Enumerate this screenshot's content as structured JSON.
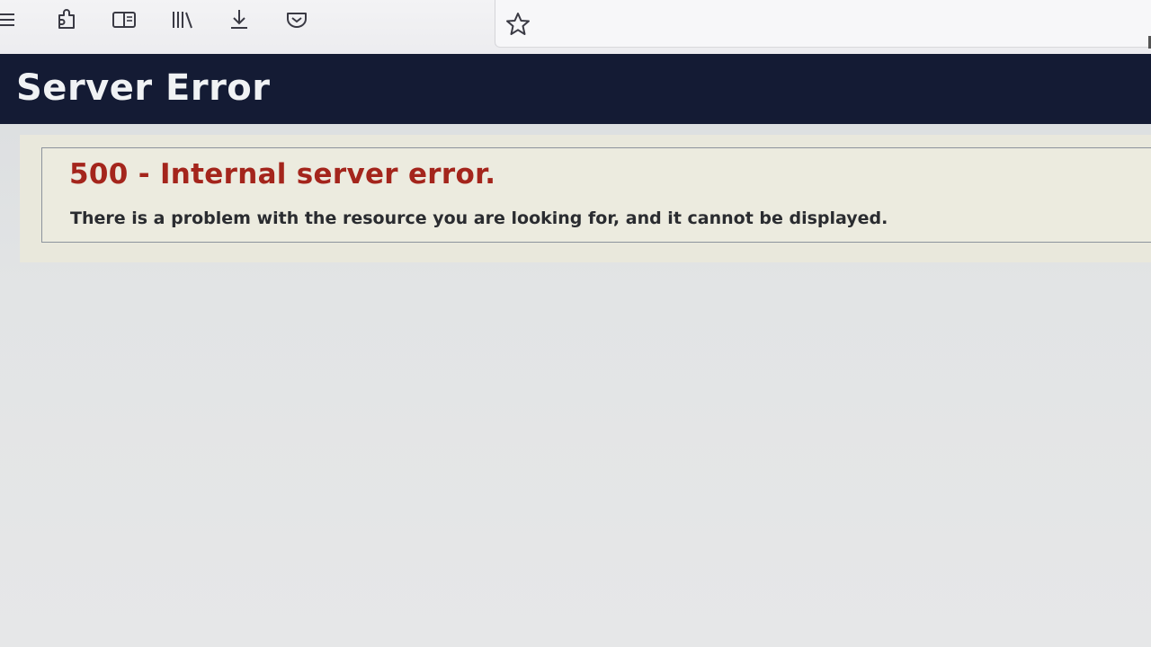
{
  "toolbar": {
    "icons": [
      "menu-icon",
      "extensions-icon",
      "reader-view-icon",
      "library-icon",
      "downloads-icon",
      "pocket-icon"
    ],
    "bookmark_icon": "star-icon"
  },
  "banner": {
    "title": "Server Error",
    "background_color": "#141b34"
  },
  "error": {
    "heading": "500 - Internal server error.",
    "message": "There is a problem with the resource you are looking for, and it cannot be displayed.",
    "heading_color": "#a4251c"
  }
}
